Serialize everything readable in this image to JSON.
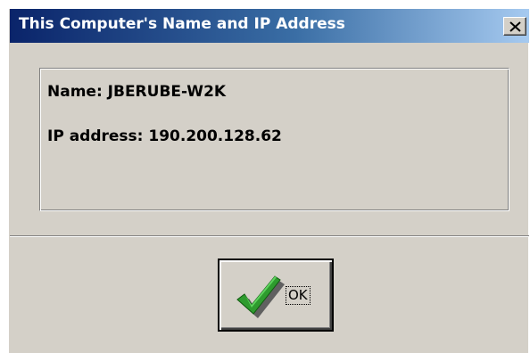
{
  "window": {
    "title": "This Computer's Name and IP Address"
  },
  "info": {
    "name_line": "Name: JBERUBE-W2K",
    "ip_line": "IP address: 190.200.128.62"
  },
  "buttons": {
    "ok_label": "OK"
  },
  "icons": {
    "close": "close-icon",
    "ok": "checkmark-icon"
  },
  "colors": {
    "titlebar_start": "#0a246a",
    "titlebar_end": "#a6caf0",
    "face": "#d4d0c8",
    "checkmark": "#2e9b2e"
  }
}
